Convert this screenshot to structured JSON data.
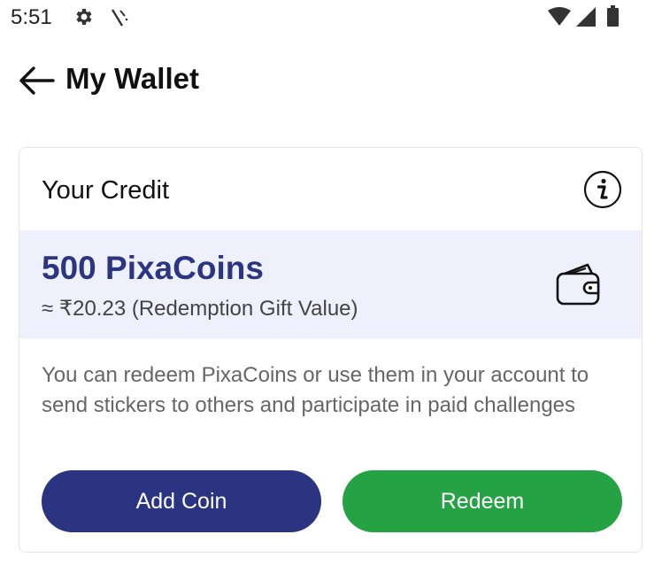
{
  "status_bar": {
    "time": "5:51",
    "icons": [
      "gear-icon",
      "no-sim-icon",
      "wifi-icon",
      "signal-icon",
      "battery-icon"
    ]
  },
  "app_bar": {
    "title": "My Wallet",
    "back_icon": "arrow-left-icon"
  },
  "credit_card": {
    "heading": "Your Credit",
    "info_icon": "info-icon",
    "balance": "500 PixaCoins",
    "gift_value": "≈ ₹20.23 (Redemption Gift Value)",
    "wallet_icon": "wallet-icon",
    "description": "You can redeem PixaCoins or use them in your account to send stickers to others and participate in paid challenges",
    "add_coin_label": "Add Coin",
    "redeem_label": "Redeem"
  },
  "colors": {
    "primary_navy": "#2b3481",
    "balance_text": "#2c3581",
    "redeem_green": "#25a244",
    "panel_bg": "#eef1fb",
    "description_text": "#666666"
  }
}
